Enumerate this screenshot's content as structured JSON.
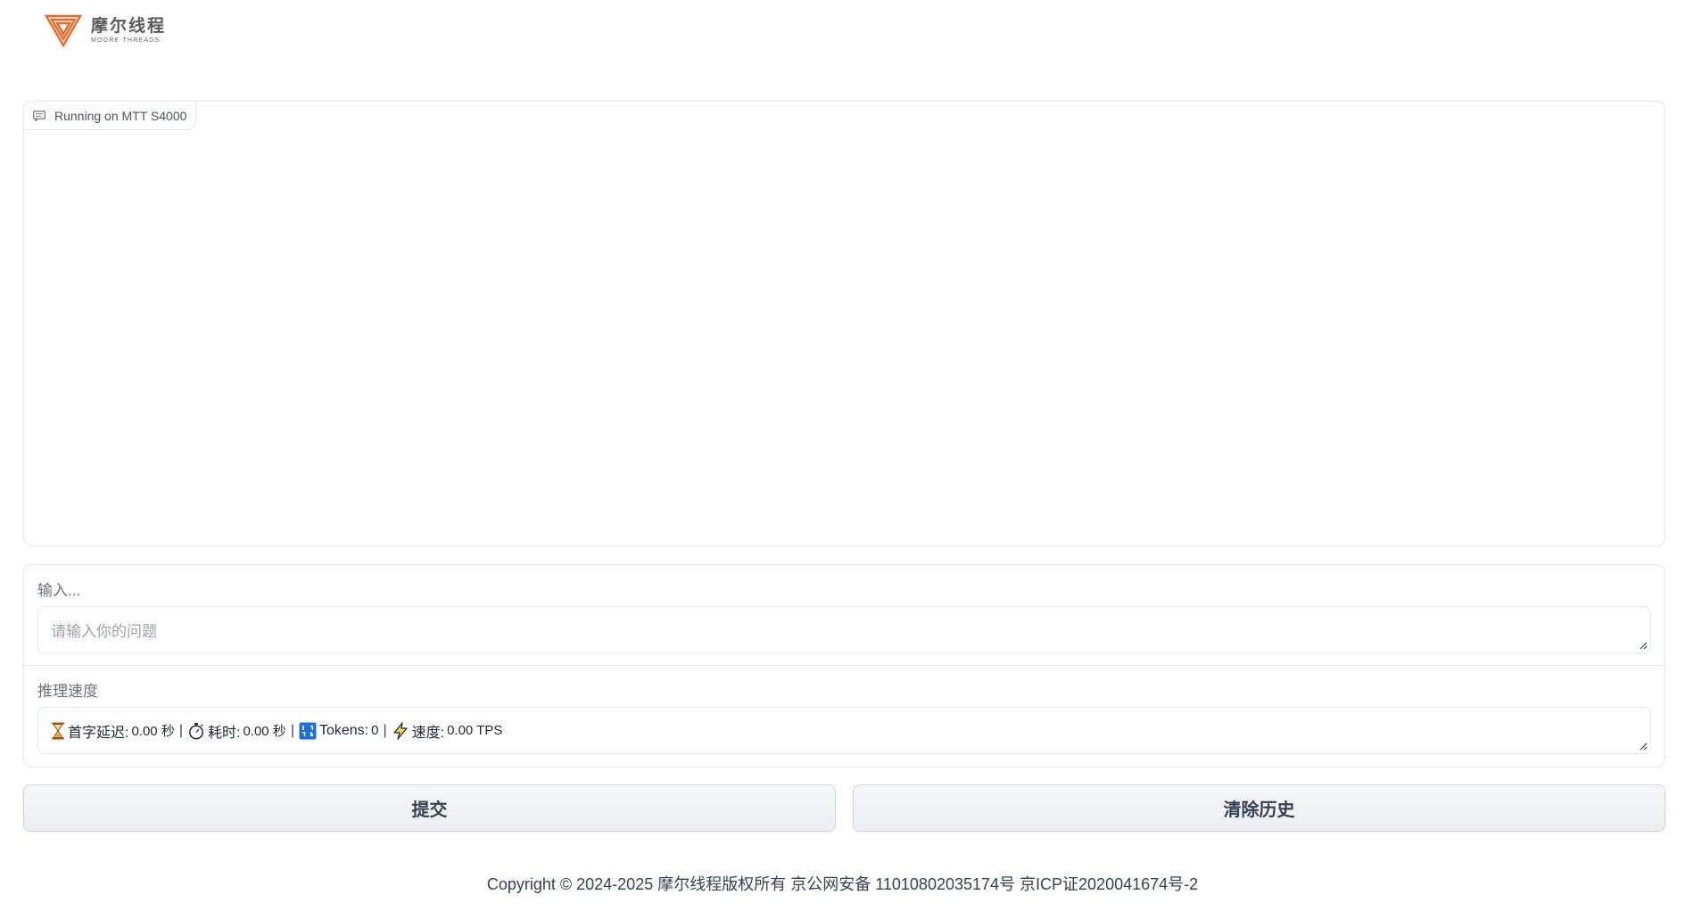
{
  "brand": {
    "name_cn": "摩尔线程",
    "name_en": "MOORE THREADS",
    "accent_color": "#f26522"
  },
  "chatbot": {
    "label": "Running on MTT S4000"
  },
  "input_section": {
    "label": "输入...",
    "placeholder": "请输入你的问题",
    "value": ""
  },
  "speed_section": {
    "label": "推理速度",
    "first_token_label": "首字延迟:",
    "first_token_value": "0.00 秒",
    "elapsed_label": "耗时:",
    "elapsed_value": "0.00 秒",
    "tokens_label": "Tokens:",
    "tokens_value": "0",
    "speed_label": "速度:",
    "speed_value": "0.00 TPS",
    "separator": "|"
  },
  "buttons": {
    "submit": "提交",
    "clear": "清除历史"
  },
  "footer": {
    "text": "Copyright © 2024-2025 摩尔线程版权所有 京公网安备 11010802035174号 京ICP证2020041674号-2"
  },
  "icons": {
    "hourglass": "hourglass-icon",
    "stopwatch": "stopwatch-icon",
    "tokens": "input-numbers-icon",
    "speed": "lightning-icon",
    "chat": "chat-icon"
  }
}
